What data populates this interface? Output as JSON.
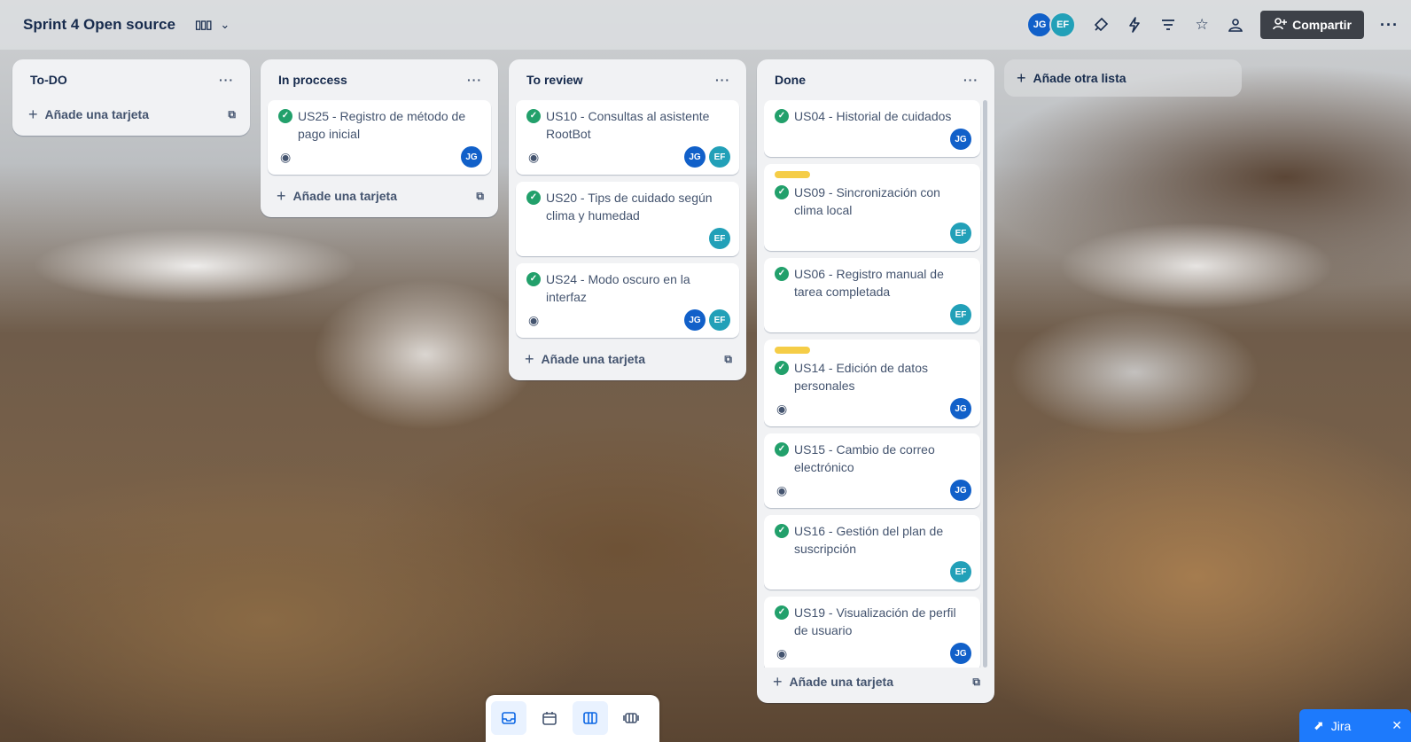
{
  "board": {
    "title": "Sprint 4 Open source"
  },
  "header": {
    "view_icon": "board-view-icon",
    "members": [
      "JG",
      "EF"
    ],
    "share_label": "Compartir",
    "colors": {
      "jg": "#1160c9",
      "ef": "#22a0b8",
      "share_bg": "#3d4148"
    }
  },
  "lists": [
    {
      "title": "To-DO",
      "cards": [],
      "add_label": "Añade una tarjeta"
    },
    {
      "title": "In proccess",
      "add_label": "Añade una tarjeta",
      "cards": [
        {
          "title": "US25 - Registro de método de pago inicial",
          "watch": true,
          "members": [
            "JG"
          ]
        }
      ]
    },
    {
      "title": "To review",
      "add_label": "Añade una tarjeta",
      "cards": [
        {
          "title": "US10 - Consultas al asistente RootBot",
          "watch": true,
          "members": [
            "JG",
            "EF"
          ]
        },
        {
          "title": "US20 - Tips de cuidado según clima y humedad",
          "watch": false,
          "members": [
            "EF"
          ]
        },
        {
          "title": "US24 - Modo oscuro en la interfaz",
          "watch": true,
          "members": [
            "JG",
            "EF"
          ]
        }
      ]
    },
    {
      "title": "Done",
      "add_label": "Añade una tarjeta",
      "cards": [
        {
          "title": "US04 - Historial de cuidados",
          "watch": false,
          "members": [
            "JG"
          ]
        },
        {
          "title": "US09 - Sincronización con clima local",
          "label": "yellow",
          "watch": false,
          "members": [
            "EF"
          ]
        },
        {
          "title": "US06 - Registro manual de tarea completada",
          "watch": false,
          "members": [
            "EF"
          ]
        },
        {
          "title": "US14 - Edición de datos personales",
          "label": "yellow",
          "watch": true,
          "members": [
            "JG"
          ]
        },
        {
          "title": "US15 - Cambio de correo electrónico",
          "watch": true,
          "members": [
            "JG"
          ]
        },
        {
          "title": "US16 - Gestión del plan de suscripción",
          "watch": false,
          "members": [
            "EF"
          ]
        },
        {
          "title": "US19 - Visualización de perfil de usuario",
          "watch": true,
          "members": [
            "JG"
          ]
        }
      ]
    }
  ],
  "add_list_label": "Añade otra lista",
  "bottom_views": [
    "inbox-icon",
    "calendar-icon",
    "board-icon",
    "switch-boards-icon"
  ],
  "jira_tab": {
    "label": "Jira"
  }
}
